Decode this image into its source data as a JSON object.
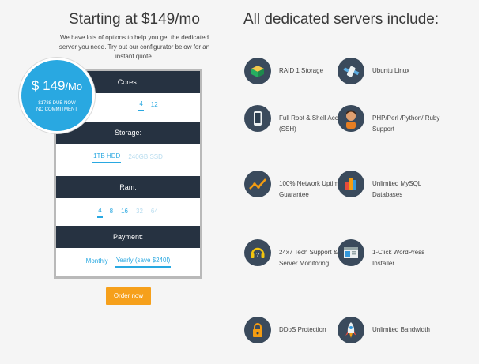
{
  "left": {
    "title": "Starting at $149/mo",
    "intro": "We have lots of options to help you get the dedicated server you need. Try out our configurator below for an instant quote.",
    "badge": {
      "price": "$ 149",
      "per": "/Mo",
      "due": "$1788 DUE NOW",
      "commitment": "NO COMMITMENT"
    },
    "sections": [
      {
        "label": "Cores:",
        "options": [
          {
            "text": "4",
            "state": "selected"
          },
          {
            "text": "12",
            "state": "normal"
          }
        ]
      },
      {
        "label": "Storage:",
        "options": [
          {
            "text": "1TB HDD",
            "state": "selected"
          },
          {
            "text": "240GB SSD",
            "state": "disabled"
          }
        ]
      },
      {
        "label": "Ram:",
        "options": [
          {
            "text": "4",
            "state": "selected"
          },
          {
            "text": "8",
            "state": "normal"
          },
          {
            "text": "16",
            "state": "normal"
          },
          {
            "text": "32",
            "state": "disabled"
          },
          {
            "text": "64",
            "state": "disabled"
          }
        ]
      },
      {
        "label": "Payment:",
        "options": [
          {
            "text": "Monthly",
            "state": "normal"
          },
          {
            "text": "Yearly (save $240!)",
            "state": "selected"
          }
        ]
      }
    ],
    "order_label": "Order now"
  },
  "right": {
    "title": "All dedicated servers include:",
    "features": [
      {
        "icon": "storage-box-icon",
        "label": "RAID 1 Storage"
      },
      {
        "icon": "ubuntu-satellite-icon",
        "label": "Ubuntu Linux"
      },
      {
        "icon": "phone-device-icon",
        "label": "Full Root & Shell Access (SSH)"
      },
      {
        "icon": "developer-avatar-icon",
        "label": "PHP/Perl /Python/ Ruby Support"
      },
      {
        "icon": "uptime-graph-icon",
        "label": "100% Network Uptime Guarantee"
      },
      {
        "icon": "database-bars-icon",
        "label": "Unlimited MySQL Databases"
      },
      {
        "icon": "support-headset-icon",
        "label": "24x7 Tech Support & Server Monitoring"
      },
      {
        "icon": "wordpress-window-icon",
        "label": "1-Click WordPress Installer"
      },
      {
        "icon": "lock-icon",
        "label": "DDoS Protection"
      },
      {
        "icon": "rocket-icon",
        "label": "Unlimited Bandwidth"
      }
    ]
  },
  "colors": {
    "accent": "#29a8e1",
    "band": "#263241",
    "order": "#f6a01b",
    "icon_bg": "#3a4a5c"
  }
}
